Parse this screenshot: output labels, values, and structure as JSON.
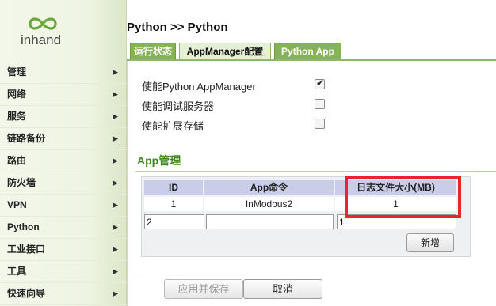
{
  "brand": {
    "logo_text": "inhand",
    "logo_color": "#6aa83c"
  },
  "sidebar": {
    "items": [
      {
        "label": "管理"
      },
      {
        "label": "网络"
      },
      {
        "label": "服务"
      },
      {
        "label": "链路备份"
      },
      {
        "label": "路由"
      },
      {
        "label": "防火墙"
      },
      {
        "label": "VPN"
      },
      {
        "label": "Python"
      },
      {
        "label": "工业接口"
      },
      {
        "label": "工具"
      },
      {
        "label": "快速向导"
      }
    ],
    "arrow_glyph": "▶"
  },
  "header": {
    "title": "Python >> Python"
  },
  "tabs": [
    {
      "label": "运行状态",
      "active": false
    },
    {
      "label": "AppManager配置",
      "active": true
    },
    {
      "label": "Python App",
      "active": false
    }
  ],
  "options": [
    {
      "label": "使能Python AppManager",
      "checked": true
    },
    {
      "label": "使能调试服务器",
      "checked": false
    },
    {
      "label": "使能扩展存储",
      "checked": false
    }
  ],
  "app_section": {
    "title": "App管理",
    "columns": [
      "ID",
      "App命令",
      "日志文件大小(MB)"
    ],
    "rows": [
      {
        "id": "1",
        "command": "InModbus2",
        "log_size": "1"
      }
    ],
    "new_row": {
      "id": "2",
      "command": "",
      "log_size": "1"
    },
    "add_button": "新增"
  },
  "actions": {
    "save_label": "应用并保存",
    "cancel_label": "取消"
  },
  "colors": {
    "accent_green": "#86b25a",
    "section_green": "#3f8a22",
    "header_blue": "#c9cde8",
    "highlight_red": "#e8252f"
  }
}
